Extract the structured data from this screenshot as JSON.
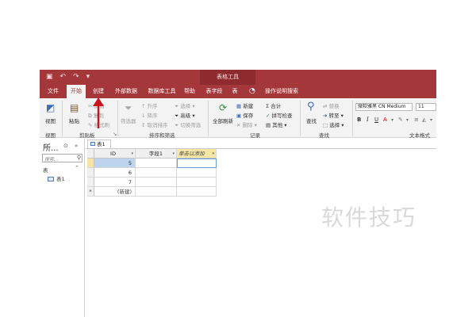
{
  "context_group": "表格工具",
  "tabs": [
    {
      "label": "文件"
    },
    {
      "label": "开始",
      "active": true
    },
    {
      "label": "创建"
    },
    {
      "label": "外部数据"
    },
    {
      "label": "数据库工具"
    },
    {
      "label": "帮助"
    },
    {
      "label": "表字段"
    },
    {
      "label": "表"
    },
    {
      "label": "操作说明搜索"
    }
  ],
  "ribbon": {
    "views": {
      "view": "视图",
      "group": "视图"
    },
    "clipboard": {
      "paste": "粘贴",
      "cut": "剪切",
      "copy": "复制",
      "painter": "格式刷",
      "group": "剪贴板"
    },
    "sort_filter": {
      "filter": "筛选器",
      "asc": "升序",
      "desc": "降序",
      "clear_sort": "取消排序",
      "selection": "选择",
      "advanced": "高级",
      "toggle": "切换筛选",
      "group": "排序和筛选"
    },
    "records": {
      "refresh": "全部刷新",
      "new": "新建",
      "save": "保存",
      "delete": "删除",
      "totals": "合计",
      "spelling": "拼写检查",
      "more": "其他",
      "group": "记录"
    },
    "find": {
      "find": "查找",
      "replace": "替换",
      "goto": "转至",
      "select": "选择",
      "group": "查找"
    },
    "text": {
      "font": "微软雅黑 CN Medium",
      "size": "11",
      "bold": "B",
      "italic": "I",
      "underline": "U",
      "group": "文本格式"
    }
  },
  "nav": {
    "title": "所...",
    "search_placeholder": "搜索...",
    "group": "表",
    "items": [
      "表1"
    ]
  },
  "doc_tab": "表1",
  "datasheet": {
    "headers": {
      "id": "ID",
      "field1": "字段1",
      "add": "单击以添加"
    },
    "rows": [
      {
        "id": "5",
        "field1": "",
        "add": ""
      },
      {
        "id": "6",
        "field1": "",
        "add": ""
      },
      {
        "id": "7",
        "field1": "",
        "add": ""
      }
    ],
    "new_row": {
      "marker": "*",
      "label": "(新建)"
    }
  },
  "watermark": "软件技巧",
  "colors": {
    "accent": "#a4373a",
    "ribbon_bg": "#f3f3f3",
    "selection": "#bcd4ee",
    "add_header": "#f6e7a7"
  }
}
